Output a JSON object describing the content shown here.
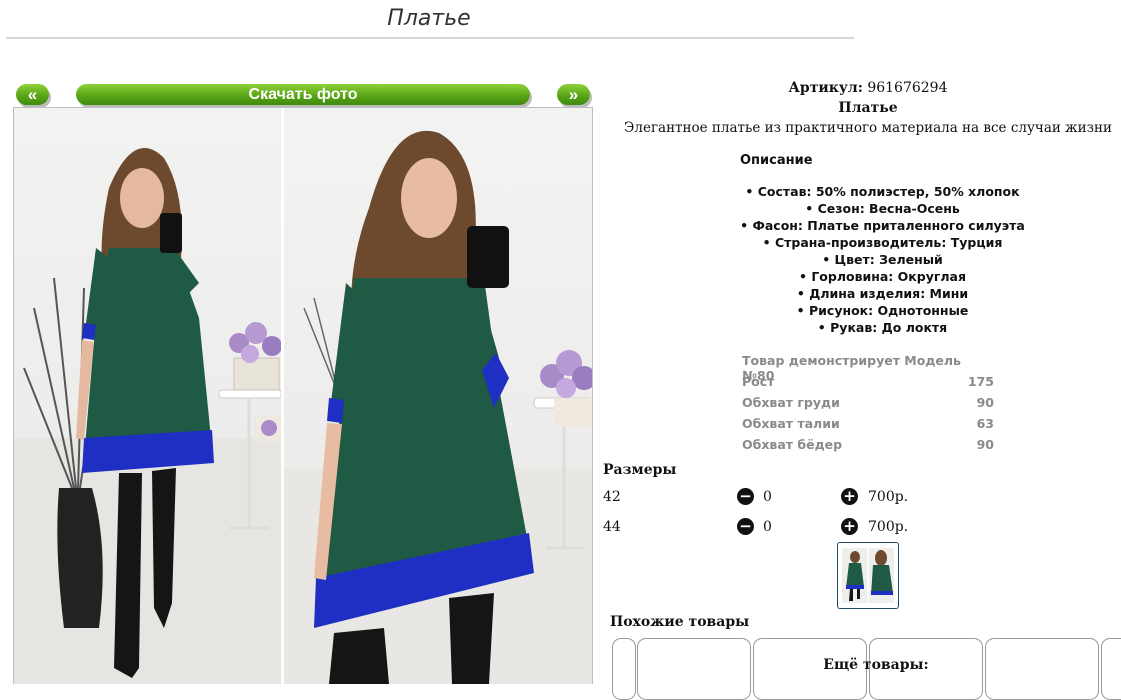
{
  "page": {
    "title": "Платье"
  },
  "gallery": {
    "prev_label": "«",
    "download_label": "Скачать фото",
    "next_label": "»"
  },
  "product": {
    "sku_label": "Артикул:",
    "sku_value": "961676294",
    "name": "Платье",
    "short_description": "Элегантное платье из практичного материала на все случаи жизни",
    "description_heading": "Описание",
    "features": [
      "Состав: 50% полиэстер, 50% хлопок",
      "Сезон: Весна-Осень",
      "Фасон: Платье приталенного силуэта",
      "Страна-производитель: Турция",
      "Цвет: Зеленый",
      "Горловина: Округлая",
      "Длина изделия: Мини",
      "Рисунок: Однотонные",
      "Рукав: До локтя"
    ]
  },
  "model": {
    "heading": "Товар демонстрирует Модель №80",
    "rows": [
      {
        "label": "Рост",
        "value": "175"
      },
      {
        "label": "Обхват груди",
        "value": "90"
      },
      {
        "label": "Обхват талии",
        "value": "63"
      },
      {
        "label": "Обхват бёдер",
        "value": "90"
      }
    ]
  },
  "sizes": {
    "heading": "Размеры",
    "rows": [
      {
        "size": "42",
        "qty": "0",
        "price": "700р."
      },
      {
        "size": "44",
        "qty": "0",
        "price": "700р."
      }
    ],
    "minus_symbol": "−",
    "plus_symbol": "+"
  },
  "similar": {
    "heading": "Похожие товары"
  },
  "more": {
    "heading": "Ещё товары:"
  },
  "colors": {
    "button_green": "#5aa517",
    "dress_green": "#1f5a44",
    "hem_blue": "#1f2fc4",
    "link_green": "#1a7a1a"
  }
}
